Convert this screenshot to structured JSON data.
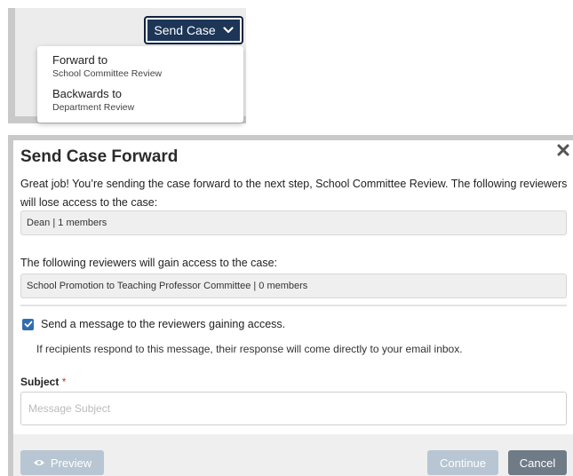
{
  "dropdown": {
    "button_label": "Send Case",
    "items": [
      {
        "title": "Forward to",
        "subtitle": "School Committee Review"
      },
      {
        "title": "Backwards to",
        "subtitle": "Department Review"
      }
    ]
  },
  "modal": {
    "title": "Send Case Forward",
    "intro": "Great job! You’re sending the case forward to the next step, School Committee Review. The following reviewers will lose access to the case:",
    "losing_group": "Dean | 1 members",
    "gain_text": "The following reviewers will gain access to the case:",
    "gaining_group": "School Promotion to Teaching Professor Committee | 0 members",
    "checkbox_label": "Send a message to the reviewers gaining access.",
    "hint": "If recipients respond to this message, their response will come directly to your email inbox.",
    "subject_label": "Subject",
    "required_mark": "*",
    "subject_placeholder": "Message Subject",
    "subject_value": ""
  },
  "footer": {
    "preview_label": "Preview",
    "continue_label": "Continue",
    "cancel_label": "Cancel"
  },
  "colors": {
    "primary": "#1d3557",
    "checkbox": "#2f6fb0",
    "disabled_button": "#b7c6d2",
    "cancel_button": "#6f7b86",
    "required": "#c0392b"
  },
  "icons": {
    "dropdown_chevron": "chevron-down-icon",
    "close": "close-icon",
    "checkbox": "check-icon",
    "preview": "eye-icon"
  }
}
